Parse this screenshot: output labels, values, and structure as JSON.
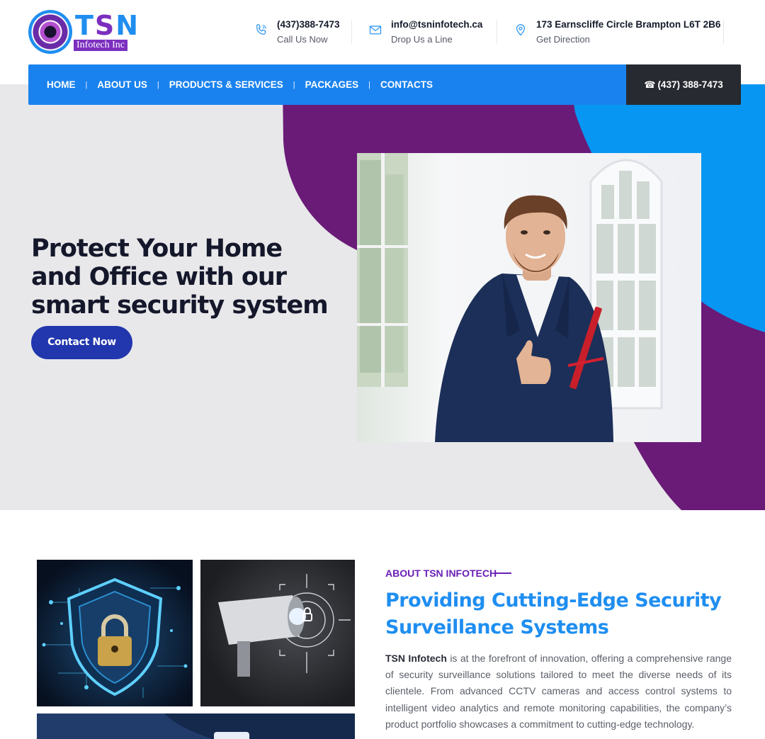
{
  "brand": {
    "name": "TSN",
    "subtitle": "Infotech Inc"
  },
  "header": {
    "phone": {
      "title": "(437)388-7473",
      "sub": "Call Us Now",
      "icon": "phone-icon"
    },
    "email": {
      "title": "info@tsninfotech.ca",
      "sub": "Drop Us a Line",
      "icon": "mail-icon"
    },
    "address": {
      "title": "173 Earnscliffe Circle Brampton L6T 2B6",
      "sub": "Get Direction",
      "icon": "location-pin-icon"
    }
  },
  "nav": {
    "items": [
      "HOME",
      "ABOUT US",
      "PRODUCTS & SERVICES",
      "PACKAGES",
      "CONTACTS"
    ],
    "separator": "|",
    "phone_label": "(437) 388-7473",
    "phone_glyph": "☎"
  },
  "hero": {
    "title": "Protect Your Home and Office with our smart security system",
    "button": "Contact Now"
  },
  "about": {
    "kicker": "ABOUT TSN INFOTECH",
    "title": "Providing Cutting-Edge Security Surveillance Systems",
    "company": "TSN Infotech",
    "body": " is at the forefront of innovation, offering a comprehensive range of security surveillance solutions tailored to meet the diverse needs of its clientele. From advanced CCTV cameras and access control systems to intelligent video analytics and remote monitoring capabilities, the company’s product portfolio showcases a commitment to cutting-edge technology."
  },
  "colors": {
    "brand_blue": "#1a82ee",
    "brand_purple": "#6a1b78",
    "button_navy": "#2236ad",
    "nav_dark": "#272a30",
    "hero_bg": "#e8e8ea"
  }
}
